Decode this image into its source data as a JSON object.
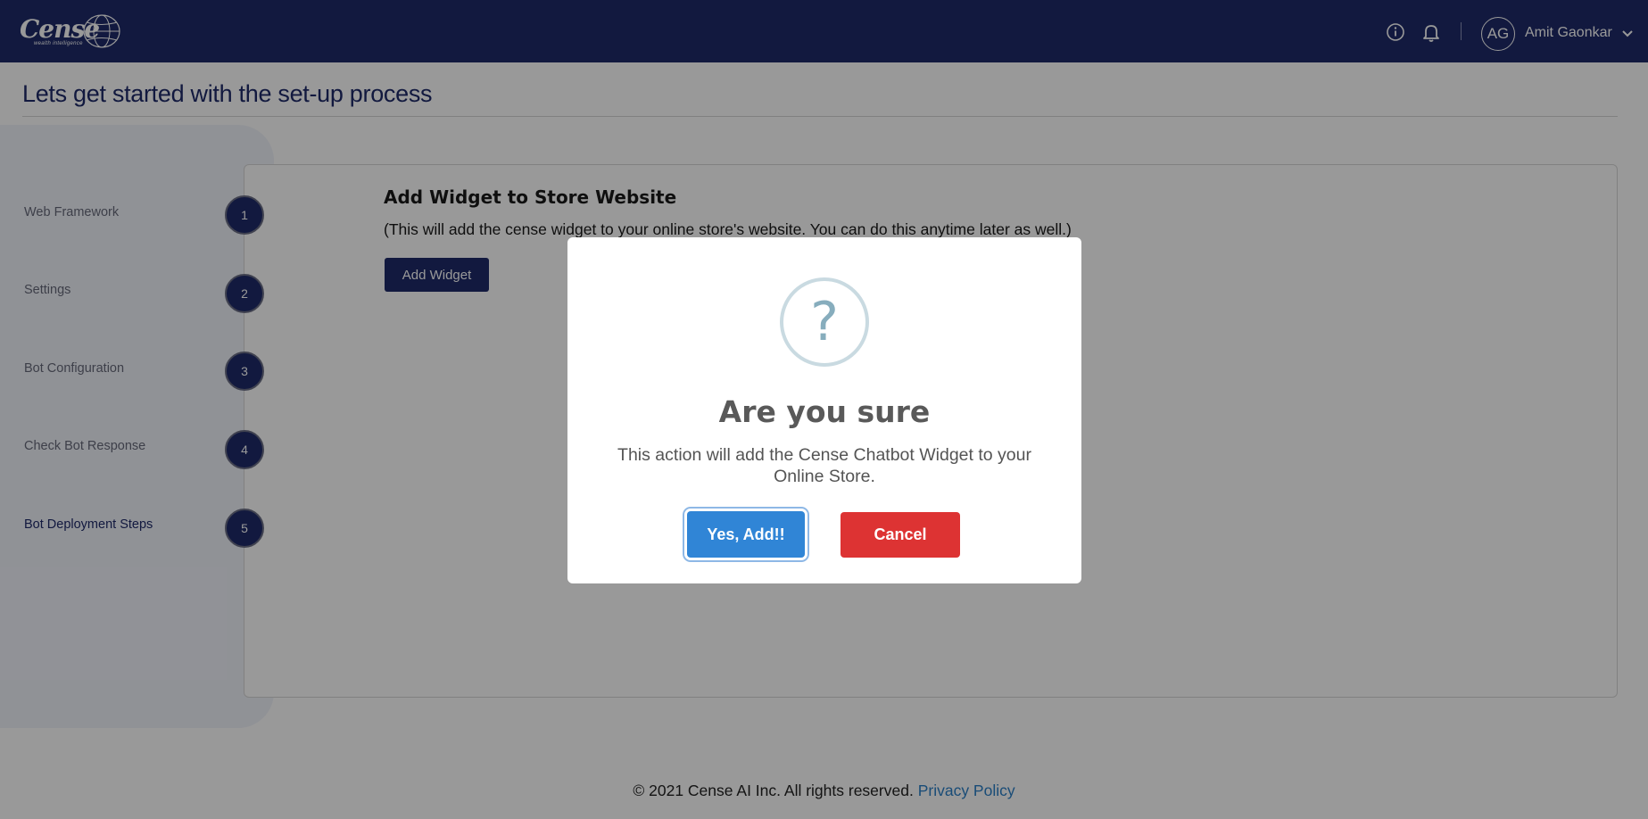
{
  "header": {
    "logo_text": "Cense",
    "logo_tagline": "wealth intelligence",
    "avatar_initials": "AG",
    "user_name": "Amit Gaonkar",
    "info_icon": "info-icon",
    "bell_icon": "bell-icon"
  },
  "page": {
    "title": "Lets get started with the set-up process"
  },
  "steps": [
    {
      "label": "Web Framework",
      "number": "1"
    },
    {
      "label": "Settings",
      "number": "2"
    },
    {
      "label": "Bot Configuration",
      "number": "3"
    },
    {
      "label": "Check Bot Response",
      "number": "4"
    },
    {
      "label": "Bot Deployment Steps",
      "number": "5"
    }
  ],
  "widget": {
    "title": "Add Widget to Store Website",
    "description": "(This will add the cense widget to your online store's website. You can do this anytime later as well.)",
    "button_label": "Add Widget"
  },
  "modal": {
    "icon": "?",
    "title": "Are you sure",
    "text": "This action will add the Cense Chatbot Widget to your Online Store.",
    "confirm_label": "Yes, Add!!",
    "cancel_label": "Cancel"
  },
  "footer": {
    "copyright": "© 2021 Cense AI Inc. All rights reserved.",
    "privacy_label": "Privacy Policy"
  },
  "colors": {
    "navy": "#1e2a69",
    "confirm": "#3085d6",
    "cancel": "#dd3333",
    "link": "#2b7fc7"
  }
}
